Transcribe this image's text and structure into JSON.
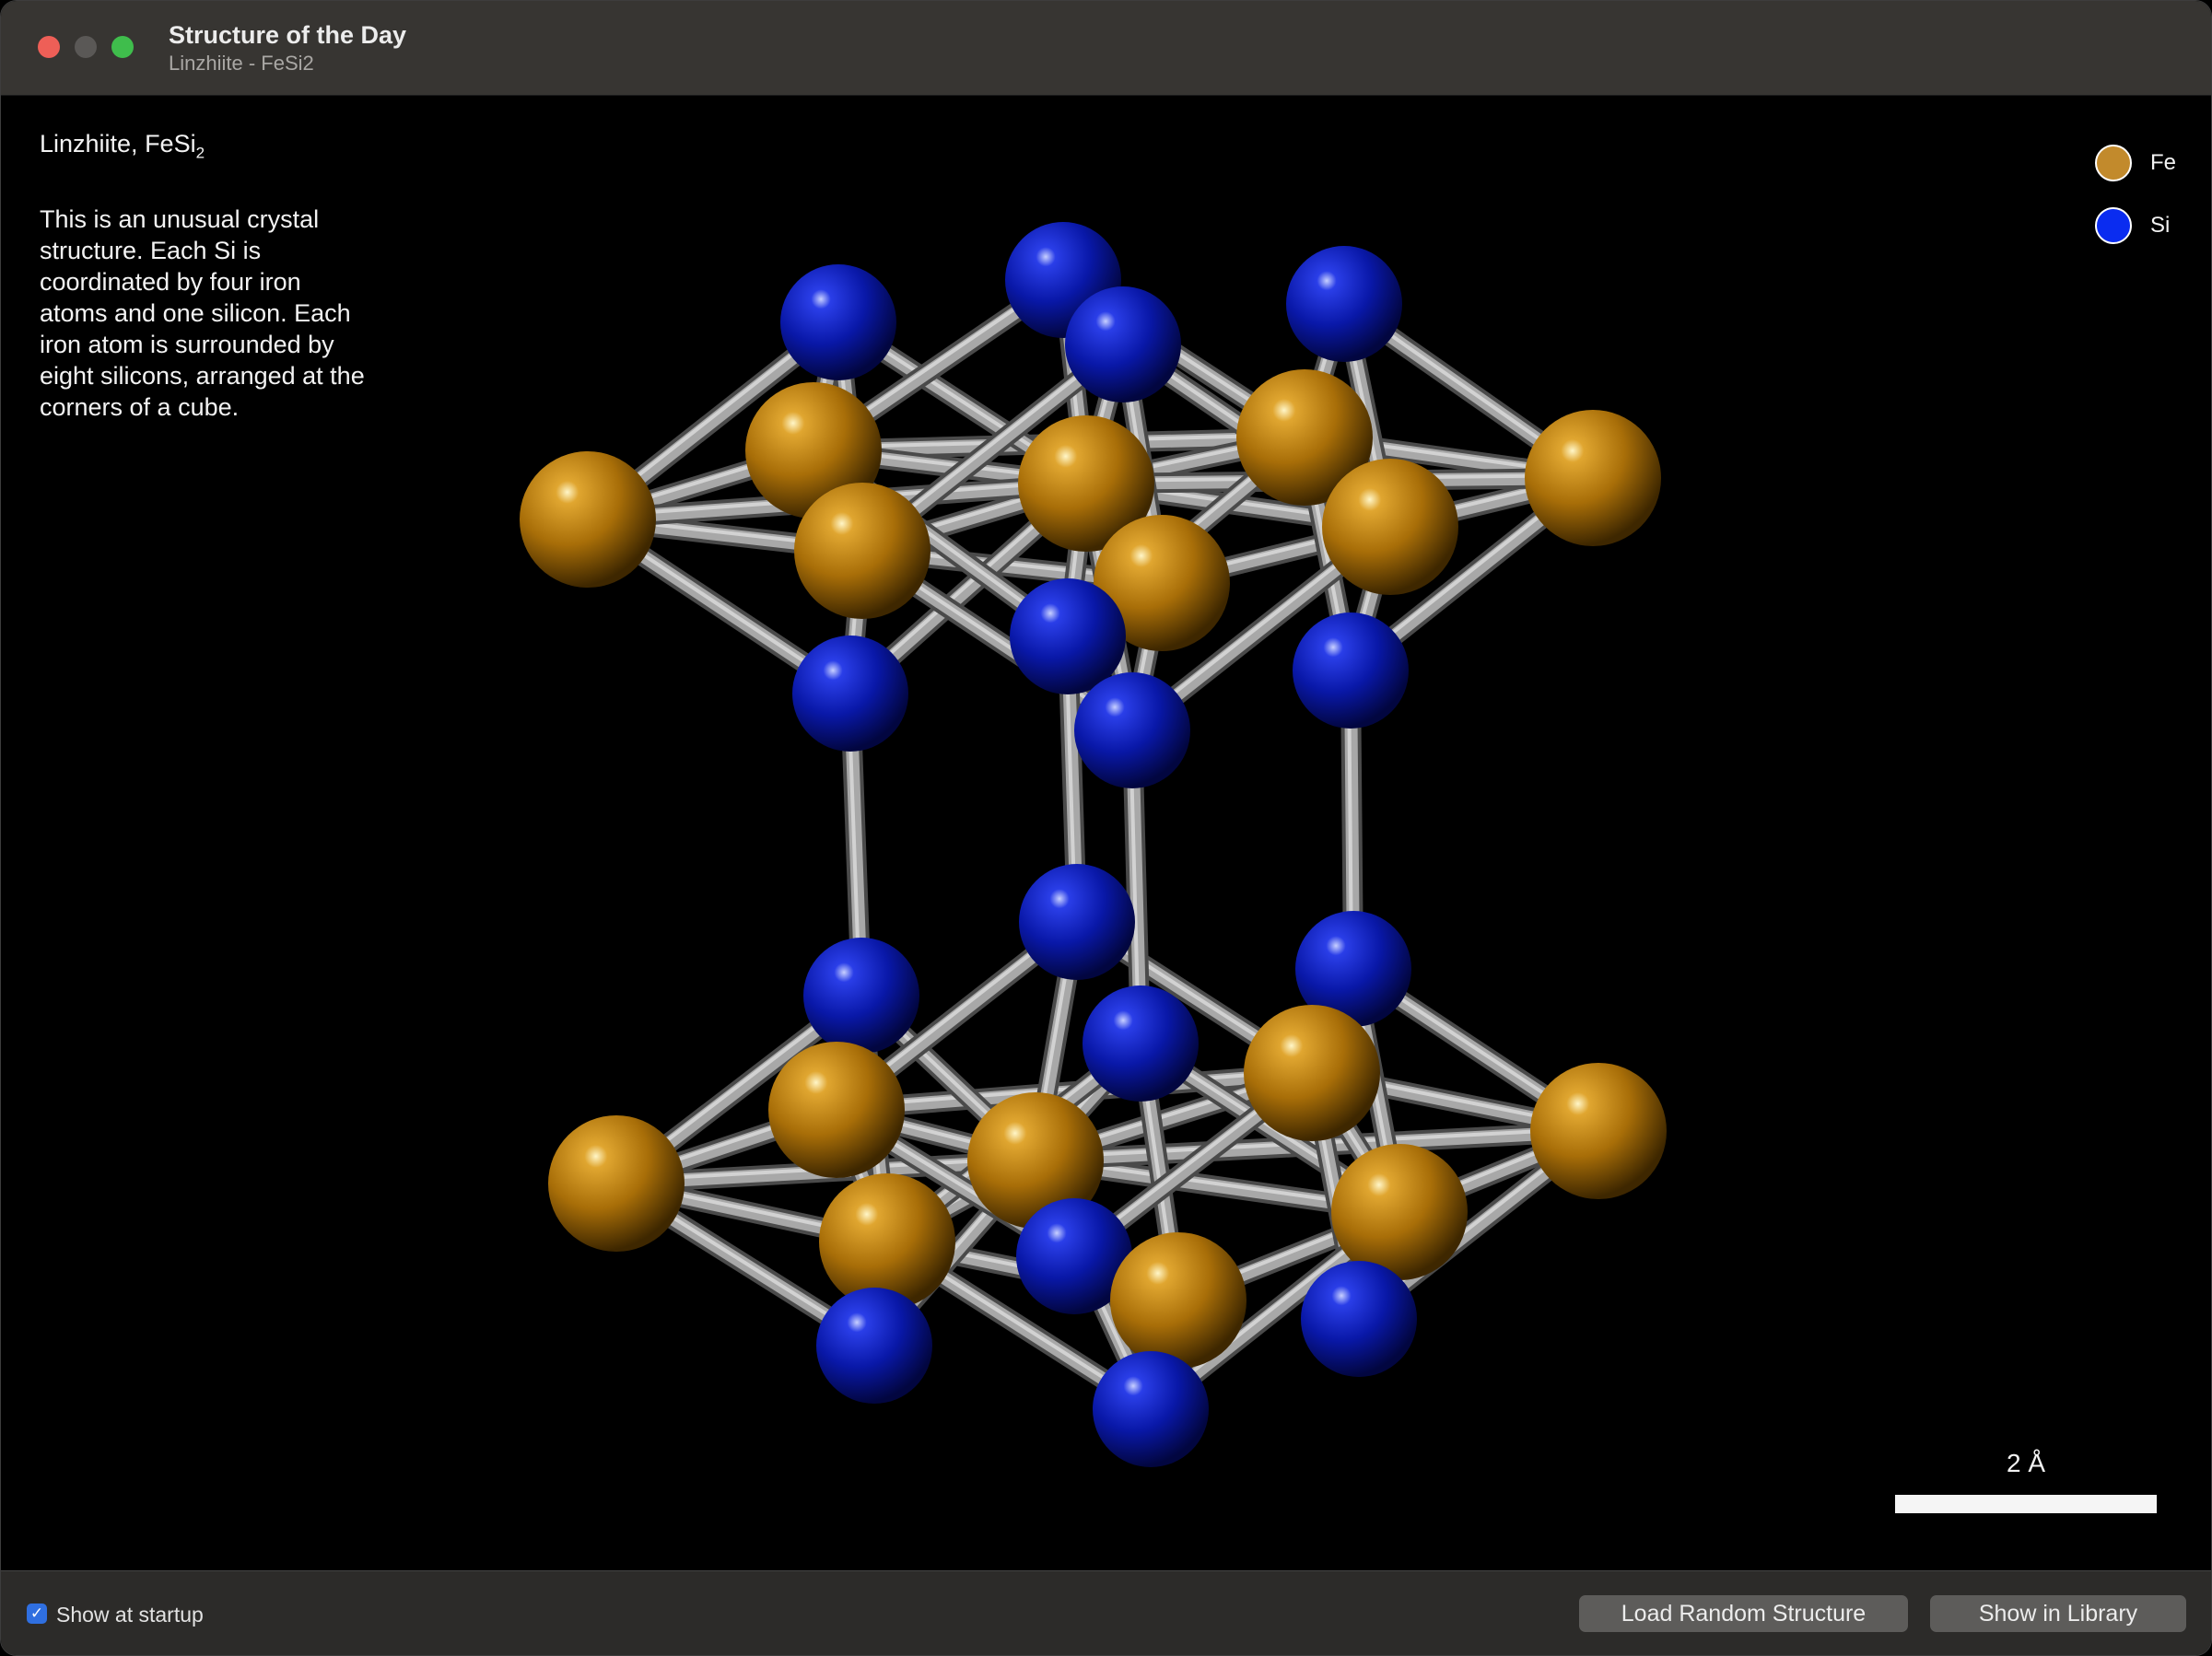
{
  "window": {
    "title": "Structure of the Day",
    "subtitle": "Linzhiite - FeSi2"
  },
  "info": {
    "title_main": "Linzhiite, FeSi",
    "title_sub": "2",
    "description": "This is an unusual crystal structure. Each Si is coordinated by four iron atoms and one silicon. Each iron atom is surrounded by eight silicons, arranged at the corners of a cube."
  },
  "legend": {
    "items": [
      {
        "symbol": "Fe",
        "color": "#c28a2c"
      },
      {
        "symbol": "Si",
        "color": "#0a2cf0"
      }
    ]
  },
  "scale": {
    "label": "2 Å"
  },
  "footer": {
    "show_at_startup_label": "Show at startup",
    "show_at_startup_checked": true,
    "load_random_label": "Load Random Structure",
    "show_library_label": "Show in Library"
  },
  "colors": {
    "fe": "#b57a10",
    "si": "#0b1eb8",
    "bond": "#9a9a9a"
  }
}
